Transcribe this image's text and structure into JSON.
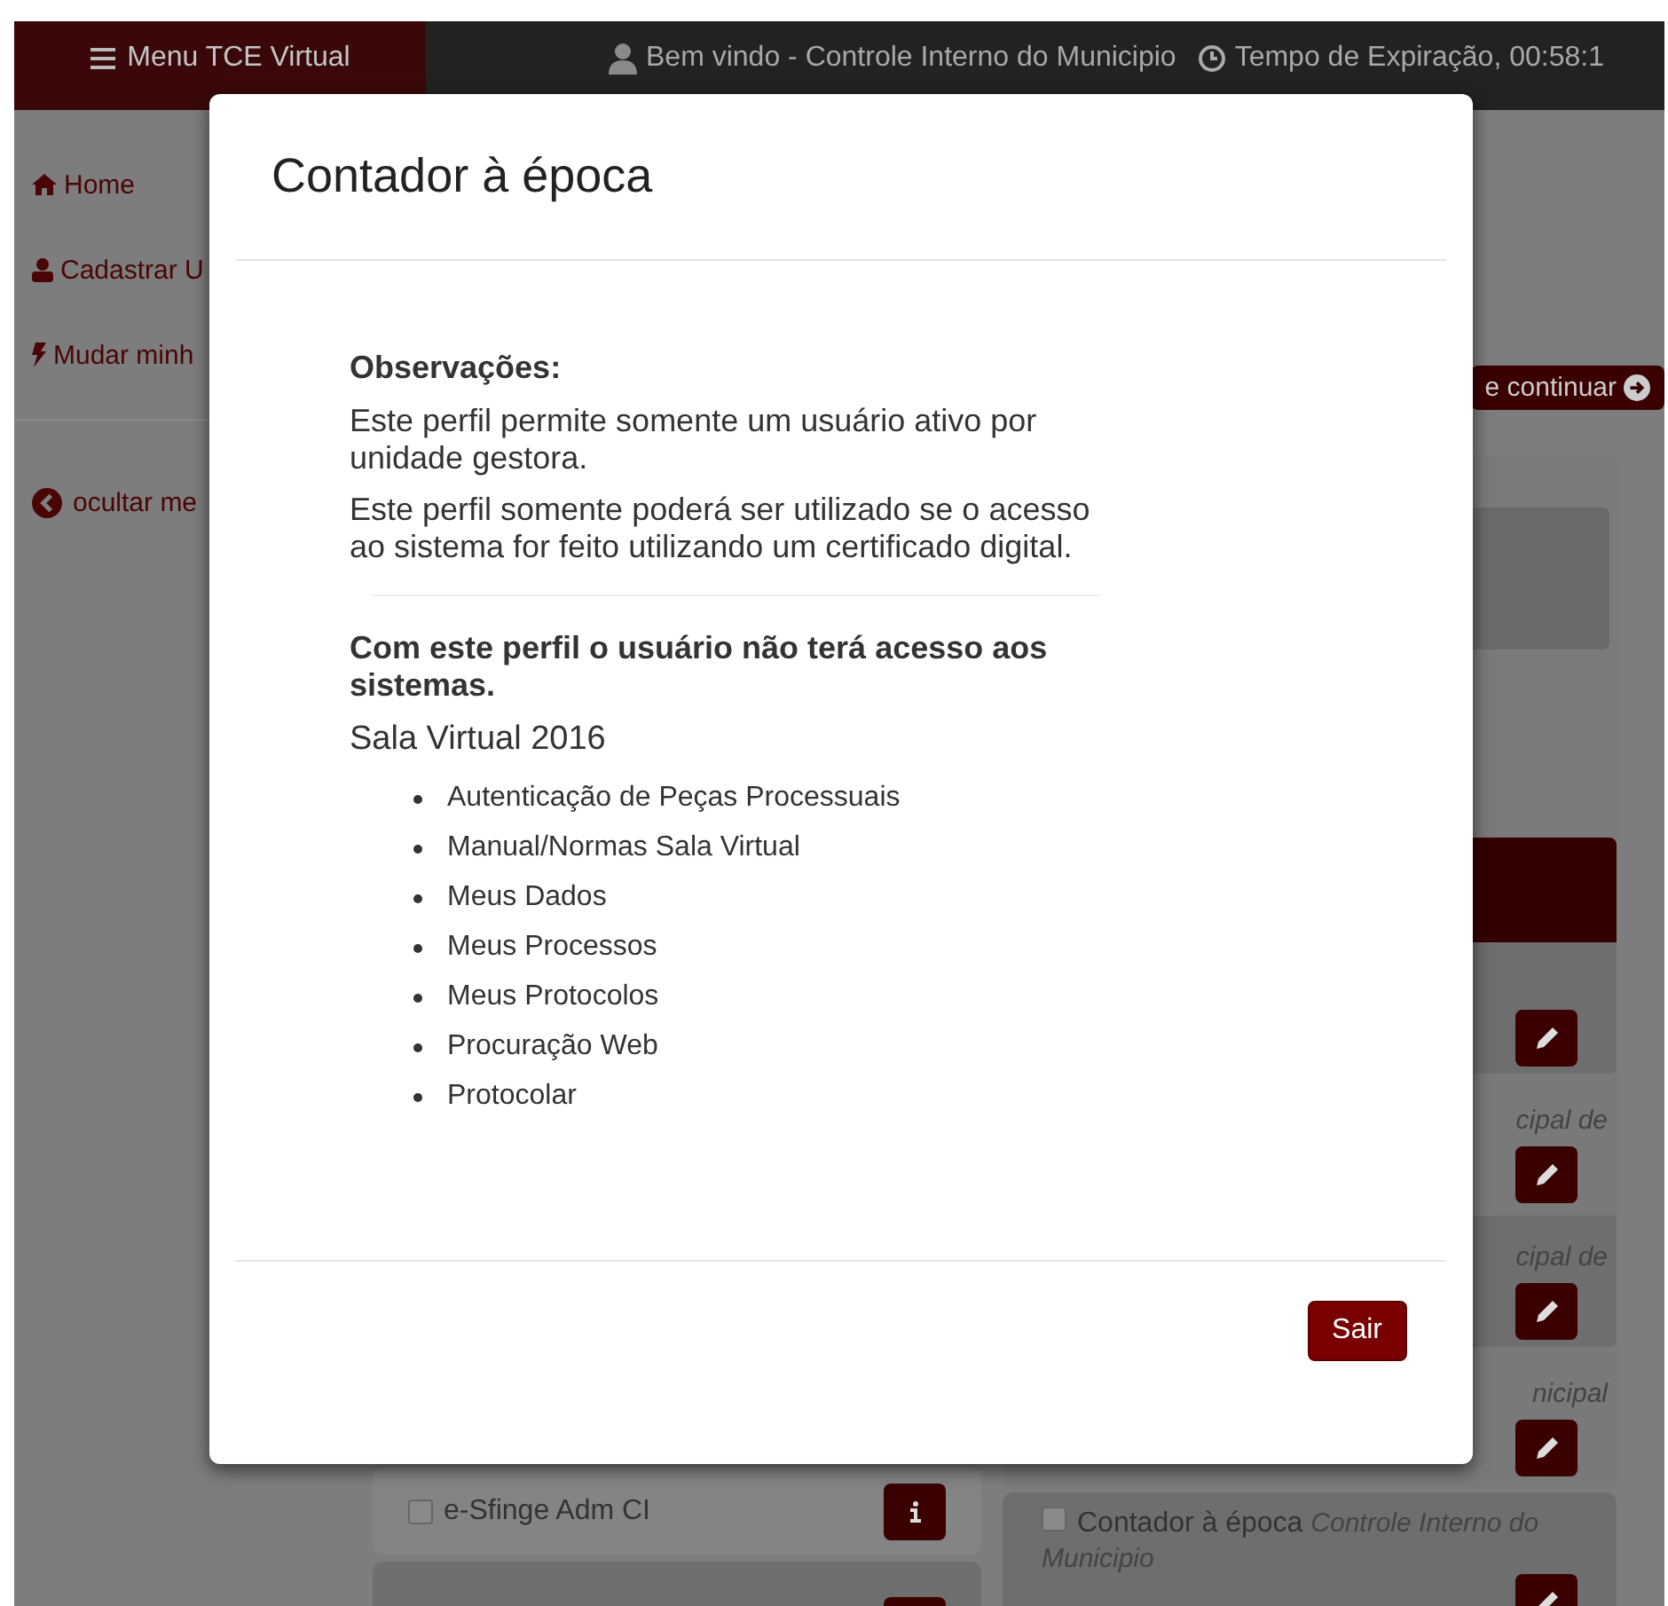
{
  "navbar": {
    "menu_button": "Menu TCE Virtual",
    "welcome": "Bem vindo - Controle Interno do Municipio",
    "expiration": "Tempo de Expiração, 00:58:1"
  },
  "sidebar": {
    "items": [
      {
        "label": "Home"
      },
      {
        "label": "Cadastrar U"
      },
      {
        "label": "Mudar minh"
      }
    ],
    "hide_menu": "ocultar me"
  },
  "continue_button": "e continuar",
  "profile_rows": [
    {
      "kind": "edit"
    },
    {
      "kind": "edit",
      "description": "cipal de"
    },
    {
      "kind": "edit",
      "description": "cipal de"
    },
    {
      "kind": "edit",
      "description": "nicipal"
    }
  ],
  "profile_cards": [
    {
      "kind": "info",
      "label": "e-Sfinge Adm CI",
      "checked": false
    },
    {
      "kind": "edit",
      "label": "Contador à época",
      "description": "Controle Interno do Municipio",
      "checked": false
    }
  ],
  "modal": {
    "title": "Contador à época",
    "observations_heading": "Observações:",
    "observations": [
      "Este perfil permite somente um usuário ativo por unidade gestora.",
      "Este perfil somente poderá ser utilizado se o acesso ao sistema for feito utilizando um certificado digital."
    ],
    "access_heading": "Com este perfil o usuário não terá acesso aos sistemas.",
    "system": "Sala Virtual 2016",
    "features": [
      "Autenticação de Peças Processuais",
      "Manual/Normas Sala Virtual",
      "Meus Dados",
      "Meus Processos",
      "Meus Protocolos",
      "Procuração Web",
      "Protocolar"
    ],
    "close_button": "Sair"
  }
}
